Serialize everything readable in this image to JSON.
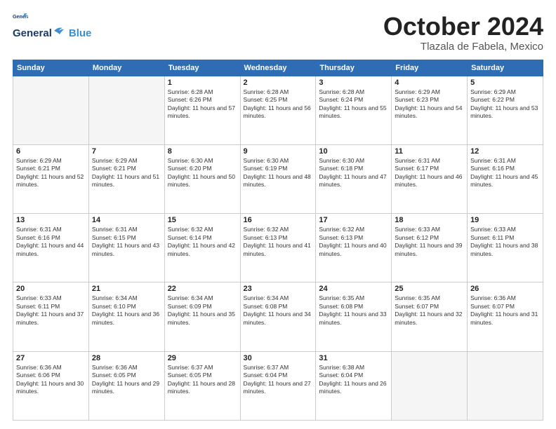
{
  "header": {
    "logo_general": "General",
    "logo_blue": "Blue",
    "month_title": "October 2024",
    "location": "Tlazala de Fabela, Mexico"
  },
  "weekdays": [
    "Sunday",
    "Monday",
    "Tuesday",
    "Wednesday",
    "Thursday",
    "Friday",
    "Saturday"
  ],
  "weeks": [
    [
      {
        "day": "",
        "empty": true
      },
      {
        "day": "",
        "empty": true
      },
      {
        "day": "1",
        "sunrise": "6:28 AM",
        "sunset": "6:26 PM",
        "daylight": "11 hours and 57 minutes."
      },
      {
        "day": "2",
        "sunrise": "6:28 AM",
        "sunset": "6:25 PM",
        "daylight": "11 hours and 56 minutes."
      },
      {
        "day": "3",
        "sunrise": "6:28 AM",
        "sunset": "6:24 PM",
        "daylight": "11 hours and 55 minutes."
      },
      {
        "day": "4",
        "sunrise": "6:29 AM",
        "sunset": "6:23 PM",
        "daylight": "11 hours and 54 minutes."
      },
      {
        "day": "5",
        "sunrise": "6:29 AM",
        "sunset": "6:22 PM",
        "daylight": "11 hours and 53 minutes."
      }
    ],
    [
      {
        "day": "6",
        "sunrise": "6:29 AM",
        "sunset": "6:21 PM",
        "daylight": "11 hours and 52 minutes."
      },
      {
        "day": "7",
        "sunrise": "6:29 AM",
        "sunset": "6:21 PM",
        "daylight": "11 hours and 51 minutes."
      },
      {
        "day": "8",
        "sunrise": "6:30 AM",
        "sunset": "6:20 PM",
        "daylight": "11 hours and 50 minutes."
      },
      {
        "day": "9",
        "sunrise": "6:30 AM",
        "sunset": "6:19 PM",
        "daylight": "11 hours and 48 minutes."
      },
      {
        "day": "10",
        "sunrise": "6:30 AM",
        "sunset": "6:18 PM",
        "daylight": "11 hours and 47 minutes."
      },
      {
        "day": "11",
        "sunrise": "6:31 AM",
        "sunset": "6:17 PM",
        "daylight": "11 hours and 46 minutes."
      },
      {
        "day": "12",
        "sunrise": "6:31 AM",
        "sunset": "6:16 PM",
        "daylight": "11 hours and 45 minutes."
      }
    ],
    [
      {
        "day": "13",
        "sunrise": "6:31 AM",
        "sunset": "6:16 PM",
        "daylight": "11 hours and 44 minutes."
      },
      {
        "day": "14",
        "sunrise": "6:31 AM",
        "sunset": "6:15 PM",
        "daylight": "11 hours and 43 minutes."
      },
      {
        "day": "15",
        "sunrise": "6:32 AM",
        "sunset": "6:14 PM",
        "daylight": "11 hours and 42 minutes."
      },
      {
        "day": "16",
        "sunrise": "6:32 AM",
        "sunset": "6:13 PM",
        "daylight": "11 hours and 41 minutes."
      },
      {
        "day": "17",
        "sunrise": "6:32 AM",
        "sunset": "6:13 PM",
        "daylight": "11 hours and 40 minutes."
      },
      {
        "day": "18",
        "sunrise": "6:33 AM",
        "sunset": "6:12 PM",
        "daylight": "11 hours and 39 minutes."
      },
      {
        "day": "19",
        "sunrise": "6:33 AM",
        "sunset": "6:11 PM",
        "daylight": "11 hours and 38 minutes."
      }
    ],
    [
      {
        "day": "20",
        "sunrise": "6:33 AM",
        "sunset": "6:11 PM",
        "daylight": "11 hours and 37 minutes."
      },
      {
        "day": "21",
        "sunrise": "6:34 AM",
        "sunset": "6:10 PM",
        "daylight": "11 hours and 36 minutes."
      },
      {
        "day": "22",
        "sunrise": "6:34 AM",
        "sunset": "6:09 PM",
        "daylight": "11 hours and 35 minutes."
      },
      {
        "day": "23",
        "sunrise": "6:34 AM",
        "sunset": "6:08 PM",
        "daylight": "11 hours and 34 minutes."
      },
      {
        "day": "24",
        "sunrise": "6:35 AM",
        "sunset": "6:08 PM",
        "daylight": "11 hours and 33 minutes."
      },
      {
        "day": "25",
        "sunrise": "6:35 AM",
        "sunset": "6:07 PM",
        "daylight": "11 hours and 32 minutes."
      },
      {
        "day": "26",
        "sunrise": "6:36 AM",
        "sunset": "6:07 PM",
        "daylight": "11 hours and 31 minutes."
      }
    ],
    [
      {
        "day": "27",
        "sunrise": "6:36 AM",
        "sunset": "6:06 PM",
        "daylight": "11 hours and 30 minutes."
      },
      {
        "day": "28",
        "sunrise": "6:36 AM",
        "sunset": "6:05 PM",
        "daylight": "11 hours and 29 minutes."
      },
      {
        "day": "29",
        "sunrise": "6:37 AM",
        "sunset": "6:05 PM",
        "daylight": "11 hours and 28 minutes."
      },
      {
        "day": "30",
        "sunrise": "6:37 AM",
        "sunset": "6:04 PM",
        "daylight": "11 hours and 27 minutes."
      },
      {
        "day": "31",
        "sunrise": "6:38 AM",
        "sunset": "6:04 PM",
        "daylight": "11 hours and 26 minutes."
      },
      {
        "day": "",
        "empty": true,
        "shaded": true
      },
      {
        "day": "",
        "empty": true,
        "shaded": true
      }
    ]
  ],
  "labels": {
    "sunrise": "Sunrise:",
    "sunset": "Sunset:",
    "daylight": "Daylight:"
  }
}
